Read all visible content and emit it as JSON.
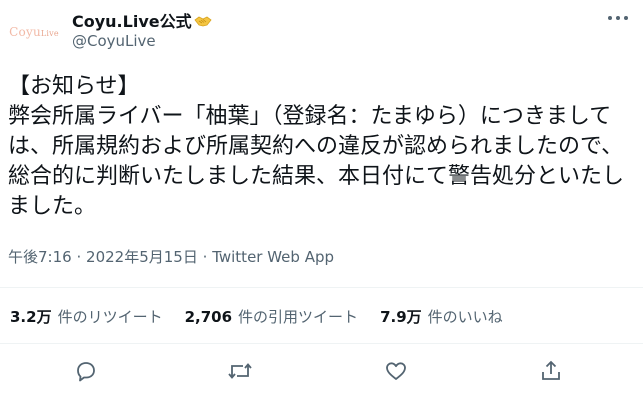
{
  "author": {
    "avatar_text_main": "Coyu",
    "avatar_text_sub": "Live",
    "display_name": "Coyu.Live公式",
    "handle": "@CoyuLive"
  },
  "tweet": {
    "text": "【お知らせ】\n弊会所属ライバー「柚葉」（登録名：たまゆら）につきましては、所属規約および所属契約への違反が認められましたので、総合的に判断いたしました結果、本日付にて警告処分といたしました。",
    "time": "午後7:16",
    "date": "2022年5月15日",
    "separator": "·",
    "source": "Twitter Web App"
  },
  "stats": {
    "retweets": {
      "value": "3.2万",
      "label": "件のリツイート"
    },
    "quotes": {
      "value": "2,706",
      "label": "件の引用ツイート"
    },
    "likes": {
      "value": "7.9万",
      "label": "件のいいね"
    }
  },
  "icons": {
    "verified_emoji": "handshake-icon",
    "more": "more-icon",
    "reply": "reply-icon",
    "retweet": "retweet-icon",
    "like": "like-icon",
    "share": "share-icon"
  },
  "colors": {
    "text_primary": "#0f1419",
    "text_secondary": "#536471",
    "divider": "#eff3f4",
    "avatar_text": "#f2b9a6",
    "handshake": "#f4c542"
  }
}
